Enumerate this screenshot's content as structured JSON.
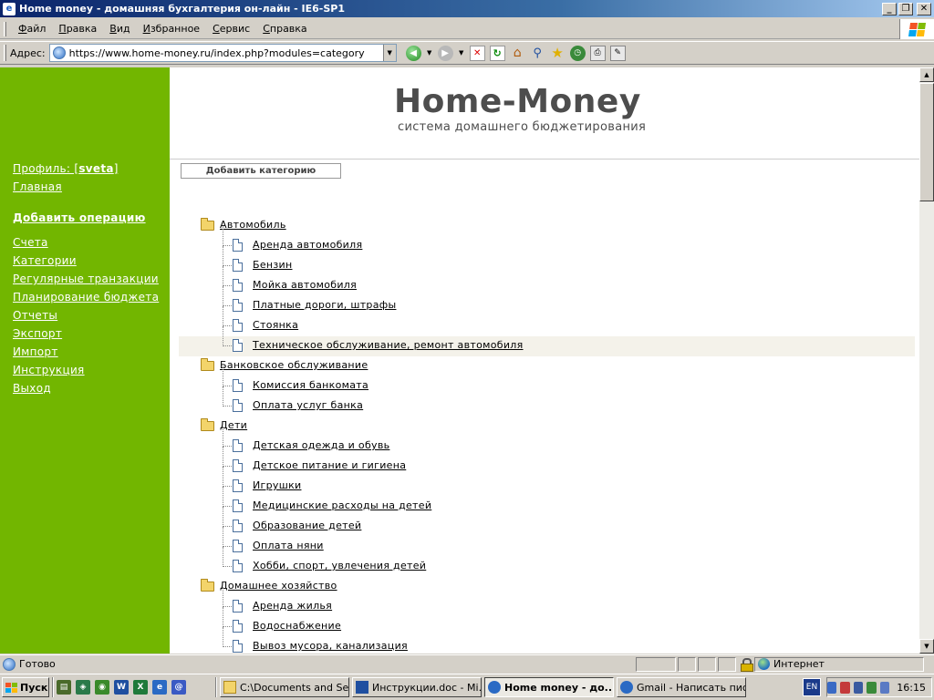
{
  "window": {
    "title": "Home money - домашняя бухгалтерия он-лайн - IE6-SP1"
  },
  "menu": [
    "Файл",
    "Правка",
    "Вид",
    "Избранное",
    "Сервис",
    "Справка"
  ],
  "address": {
    "label": "Адрес:",
    "url": "https://www.home-money.ru/index.php?modules=category"
  },
  "sidebar": {
    "profile_label": "Профиль: [",
    "profile_user": "sveta",
    "profile_close": "]",
    "items": [
      {
        "label": "Главная"
      },
      {
        "label": "Добавить операцию"
      },
      {
        "label": "Счета"
      },
      {
        "label": "Категории"
      },
      {
        "label": "Регулярные транзакции"
      },
      {
        "label": "Планирование бюджета"
      },
      {
        "label": "Отчеты"
      },
      {
        "label": "Экспорт"
      },
      {
        "label": "Импорт"
      },
      {
        "label": "Инструкция"
      },
      {
        "label": "Выход"
      }
    ]
  },
  "logo": {
    "title": "Home-Money",
    "subtitle": "система домашнего бюджетирования"
  },
  "add_category_button": "Добавить категорию",
  "tree": [
    {
      "type": "cat",
      "label": "Автомобиль"
    },
    {
      "type": "sub",
      "label": "Аренда автомобиля"
    },
    {
      "type": "sub",
      "label": "Бензин"
    },
    {
      "type": "sub",
      "label": "Мойка автомобиля"
    },
    {
      "type": "sub",
      "label": "Платные дороги, штрафы"
    },
    {
      "type": "sub",
      "label": "Стоянка"
    },
    {
      "type": "sub",
      "label": "Техническое обслуживание, ремонт автомобиля",
      "highlight": true
    },
    {
      "type": "cat",
      "label": "Банковское обслуживание"
    },
    {
      "type": "sub",
      "label": "Комиссия банкомата"
    },
    {
      "type": "sub",
      "label": "Оплата услуг банка"
    },
    {
      "type": "cat",
      "label": "Дети"
    },
    {
      "type": "sub",
      "label": "Детская одежда и обувь"
    },
    {
      "type": "sub",
      "label": "Детское питание и гигиена"
    },
    {
      "type": "sub",
      "label": "Игрушки"
    },
    {
      "type": "sub",
      "label": "Медицинские расходы на детей"
    },
    {
      "type": "sub",
      "label": "Образование детей"
    },
    {
      "type": "sub",
      "label": "Оплата няни"
    },
    {
      "type": "sub",
      "label": "Хобби, спорт, увлечения детей"
    },
    {
      "type": "cat",
      "label": "Домашнее хозяйство"
    },
    {
      "type": "sub",
      "label": "Аренда жилья"
    },
    {
      "type": "sub",
      "label": "Водоснабжение"
    },
    {
      "type": "sub",
      "label": "Вывоз мусора, канализация"
    }
  ],
  "status": {
    "text": "Готово",
    "zone": "Интернет"
  },
  "taskbar": {
    "start": "Пуск",
    "tasks": [
      {
        "label": "C:\\Documents and Se...",
        "active": false
      },
      {
        "label": "Инструкции.doc - Mi...",
        "active": false
      },
      {
        "label": "Home money - до...",
        "active": true
      },
      {
        "label": "Gmail - Написать пис...",
        "active": false
      }
    ],
    "lang": "EN",
    "clock": "16:15"
  },
  "colors": {
    "sidebar_green": "#72b600",
    "titlebar_blue": "#0a246a",
    "logo_gray": "#4d4d4d"
  }
}
